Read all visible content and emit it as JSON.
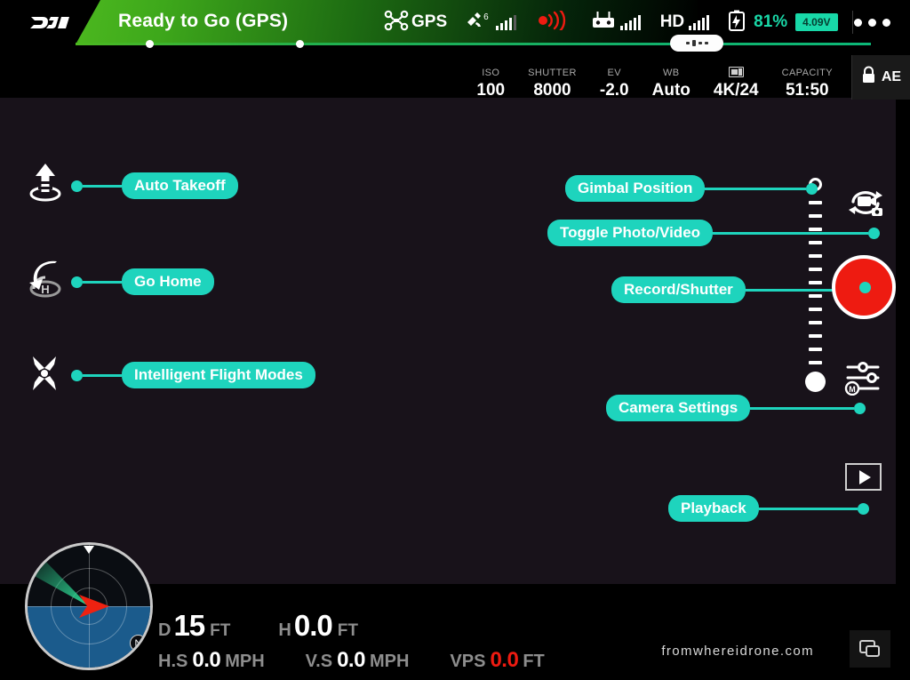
{
  "topbar": {
    "logo": "dji-logo",
    "status_title": "Ready to Go (GPS)",
    "gps_label": "GPS",
    "satellite_count": "6",
    "hd_label": "HD",
    "battery_percent": "81%",
    "voltage": "4.09V",
    "menu_label": "•••",
    "accent_green": "#4cb81f",
    "accent_teal": "#18d8a8"
  },
  "camera_bar": {
    "items": [
      {
        "key": "ISO",
        "value": "100"
      },
      {
        "key": "SHUTTER",
        "value": "8000"
      },
      {
        "key": "EV",
        "value": "-2.0"
      },
      {
        "key": "WB",
        "value": "Auto"
      },
      {
        "key": "",
        "value": "4K/24"
      },
      {
        "key": "CAPACITY",
        "value": "51:50"
      }
    ],
    "ae_lock_label": "AE"
  },
  "callouts": {
    "auto_takeoff": "Auto Takeoff",
    "go_home": "Go Home",
    "intelligent_flight_modes": "Intelligent Flight Modes",
    "gimbal_position": "Gimbal Position",
    "toggle_photo_video": "Toggle Photo/Video",
    "record_shutter": "Record/Shutter",
    "camera_settings": "Camera Settings",
    "playback": "Playback",
    "pill_color": "#1ed4bd"
  },
  "telemetry": {
    "distance": {
      "key": "D",
      "value": "15",
      "unit": "FT"
    },
    "height": {
      "key": "H",
      "value": "0.0",
      "unit": "FT"
    },
    "horizontal_speed": {
      "key": "H.S",
      "value": "0.0",
      "unit": "MPH"
    },
    "vertical_speed": {
      "key": "V.S",
      "value": "0.0",
      "unit": "MPH"
    },
    "vps": {
      "key": "VPS",
      "value": "0.0",
      "unit": "FT",
      "color": "#ee1b11"
    }
  },
  "radar": {
    "north_label": "N"
  },
  "watermark": "fromwhereidrone.com"
}
